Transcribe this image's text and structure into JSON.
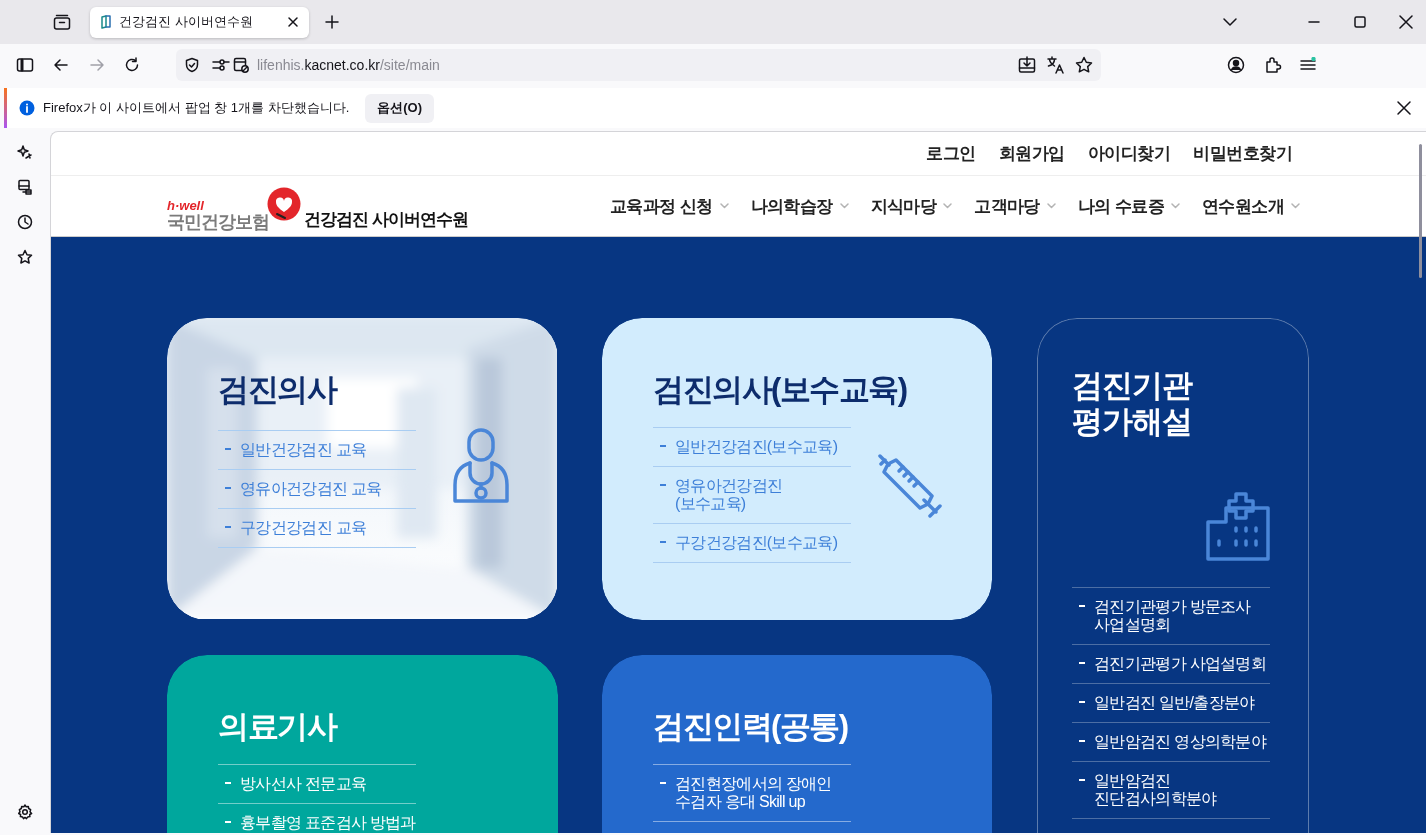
{
  "browser": {
    "tab": {
      "title": "건강검진 사이버연수원",
      "selected": true
    },
    "forward_disabled": true,
    "url_parts": [
      "lifenhis.",
      "kacnet.co.kr",
      "/site/main"
    ],
    "notification": {
      "message": "Firefox가 이 사이트에서 팝업 창 1개를 차단했습니다.",
      "button": "옵션(O)"
    }
  },
  "site": {
    "top_links": [
      "로그인",
      "회원가입",
      "아이디찾기",
      "비밀번호찾기"
    ],
    "logo": {
      "tagline": "h·well",
      "org": "국민건강보험",
      "name": "건강검진 사이버연수원"
    },
    "nav": [
      "교육과정 신청",
      "나의학습장",
      "지식마당",
      "고객마당",
      "나의 수료증",
      "연수원소개"
    ]
  },
  "cards": [
    {
      "title": "검진의사",
      "items": [
        "일반건강검진 교육",
        "영유아건강검진 교육",
        "구강건강검진 교육"
      ]
    },
    {
      "kind": "light",
      "title": "검진의사(보수교육)",
      "items": [
        "일반건강검진(보수교육)",
        "영유아건강검진\n(보수교육)",
        "구강건강검진(보수교육)"
      ]
    },
    {
      "kind": "outline",
      "title": "검진기관\n평가해설",
      "items": [
        "검진기관평가 방문조사\n사업설명회",
        "검진기관평가 사업설명회",
        "일반검진 일반/출장분야",
        "일반암검진 영상의학분야",
        "일반암검진\n진단검사의학분야"
      ]
    },
    {
      "kind": "teal",
      "title": "의료기사",
      "items": [
        "방사선사 전문교육",
        "흉부촬영 표준검사 방법과"
      ]
    },
    {
      "kind": "blue",
      "title": "검진인력(공통)",
      "items": [
        "검진현장에서의 장애인\n수검자 응대 Skill up"
      ]
    }
  ]
}
